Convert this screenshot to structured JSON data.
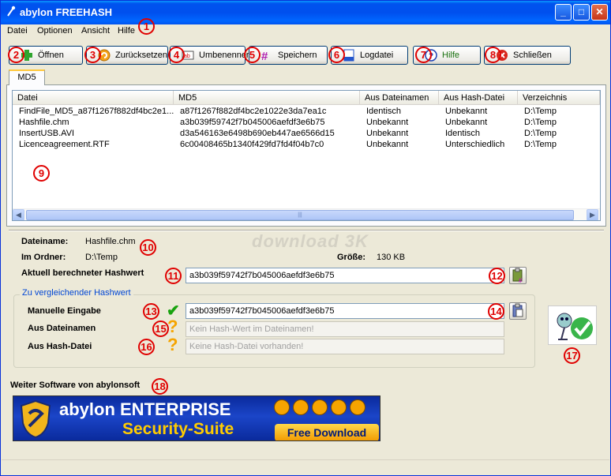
{
  "window": {
    "title": "abylon FREEHASH",
    "minimize": "_",
    "maximize": "□",
    "close": "✕"
  },
  "menu": [
    "Datei",
    "Optionen",
    "Ansicht",
    "Hilfe"
  ],
  "toolbar": [
    {
      "label": "Öffnen",
      "icon": "open-plus-icon"
    },
    {
      "label": "Zurücksetzen",
      "icon": "reset-icon"
    },
    {
      "label": "Umbenennen",
      "icon": "rename-icon"
    },
    {
      "label": "Speichern",
      "icon": "save-icon"
    },
    {
      "label": "Logdatei",
      "icon": "logfile-icon"
    },
    {
      "label": "Hilfe",
      "icon": "help-icon"
    },
    {
      "label": "Schließen",
      "icon": "close-icon"
    }
  ],
  "tab": "MD5",
  "list": {
    "columns": [
      "Datei",
      "MD5",
      "Aus Dateinamen",
      "Aus Hash-Datei",
      "Verzeichnis"
    ],
    "rows": [
      [
        "FindFile_MD5_a87f1267f882df4bc2e1...",
        "a87f1267f882df4bc2e1022e3da7ea1c",
        "Identisch",
        "Unbekannt",
        "D:\\Temp"
      ],
      [
        "Hashfile.chm",
        "a3b039f59742f7b045006aefdf3e6b75",
        "Unbekannt",
        "Unbekannt",
        "D:\\Temp"
      ],
      [
        "InsertUSB.AVI",
        "d3a546163e6498b690eb447ae6566d15",
        "Unbekannt",
        "Identisch",
        "D:\\Temp"
      ],
      [
        "Licenceagreement.RTF",
        "6c00408465b1340f429fd7fd4f04b7c0",
        "Unbekannt",
        "Unterschiedlich",
        "D:\\Temp"
      ]
    ],
    "scroll_left": "◀",
    "scroll_right": "▶",
    "scroll_grip": "|||"
  },
  "details": {
    "filename_label": "Dateiname:",
    "filename_value": "Hashfile.chm",
    "folder_label": "Im Ordner:",
    "folder_value": "D:\\Temp",
    "size_label": "Größe:",
    "size_value": "130 KB",
    "current_label": "Aktuell berechneter Hashwert",
    "current_value": "a3b039f59742f7b045006aefdf3e6b75"
  },
  "compare": {
    "legend": "Zu vergleichender Hashwert",
    "manual_label": "Manuelle Eingabe",
    "manual_value": "a3b039f59742f7b045006aefdf3e6b75",
    "manual_status": "✔",
    "from_filename_label": "Aus Dateinamen",
    "from_filename_placeholder": "Kein Hash-Wert im Dateinamen!",
    "from_filename_status": "?",
    "from_hashfile_label": "Aus Hash-Datei",
    "from_hashfile_placeholder": "Keine Hash-Datei vorhanden!",
    "from_hashfile_status": "?"
  },
  "watermark": "download 3K",
  "promo": {
    "heading": "Weiter Software von abylonsoft",
    "line1": "abylon ENTERPRISE",
    "line2": "Security-Suite",
    "button": "Free Download"
  },
  "callouts": [
    "1",
    "2",
    "3",
    "4",
    "5",
    "6",
    "7",
    "8",
    "9",
    "10",
    "11",
    "12",
    "13",
    "14",
    "15",
    "16",
    "17",
    "18"
  ],
  "colors": {
    "callout": "#e00000",
    "title_blue": "#0053ee",
    "link_blue": "#0046d5",
    "ok_green": "#19a30f",
    "warn_orange": "#f5a400"
  }
}
